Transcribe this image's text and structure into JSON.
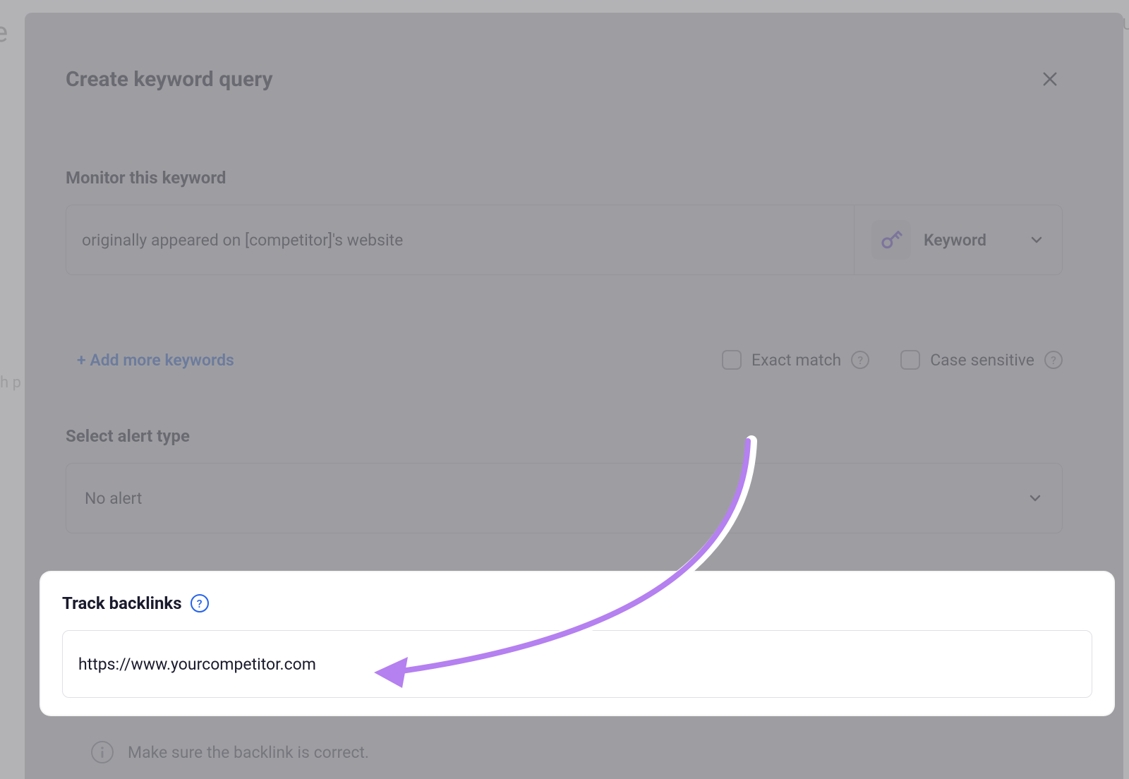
{
  "backdrop": {
    "left_char": "e",
    "left_text2": "h p",
    "right_text": "t U"
  },
  "modal": {
    "title": "Create keyword query",
    "monitor_section": {
      "heading": "Monitor this keyword",
      "input_value": "originally appeared on [competitor]'s website",
      "type_label": "Keyword"
    },
    "add_more_label": "+ Add more keywords",
    "exact_match_label": "Exact match",
    "case_sensitive_label": "Case sensitive",
    "alert_section": {
      "heading": "Select alert type",
      "value": "No alert"
    },
    "backlinks_section": {
      "heading": "Track backlinks",
      "input_value": "https://www.yourcompetitor.com"
    },
    "hint_text": "Make sure the backlink is correct."
  }
}
